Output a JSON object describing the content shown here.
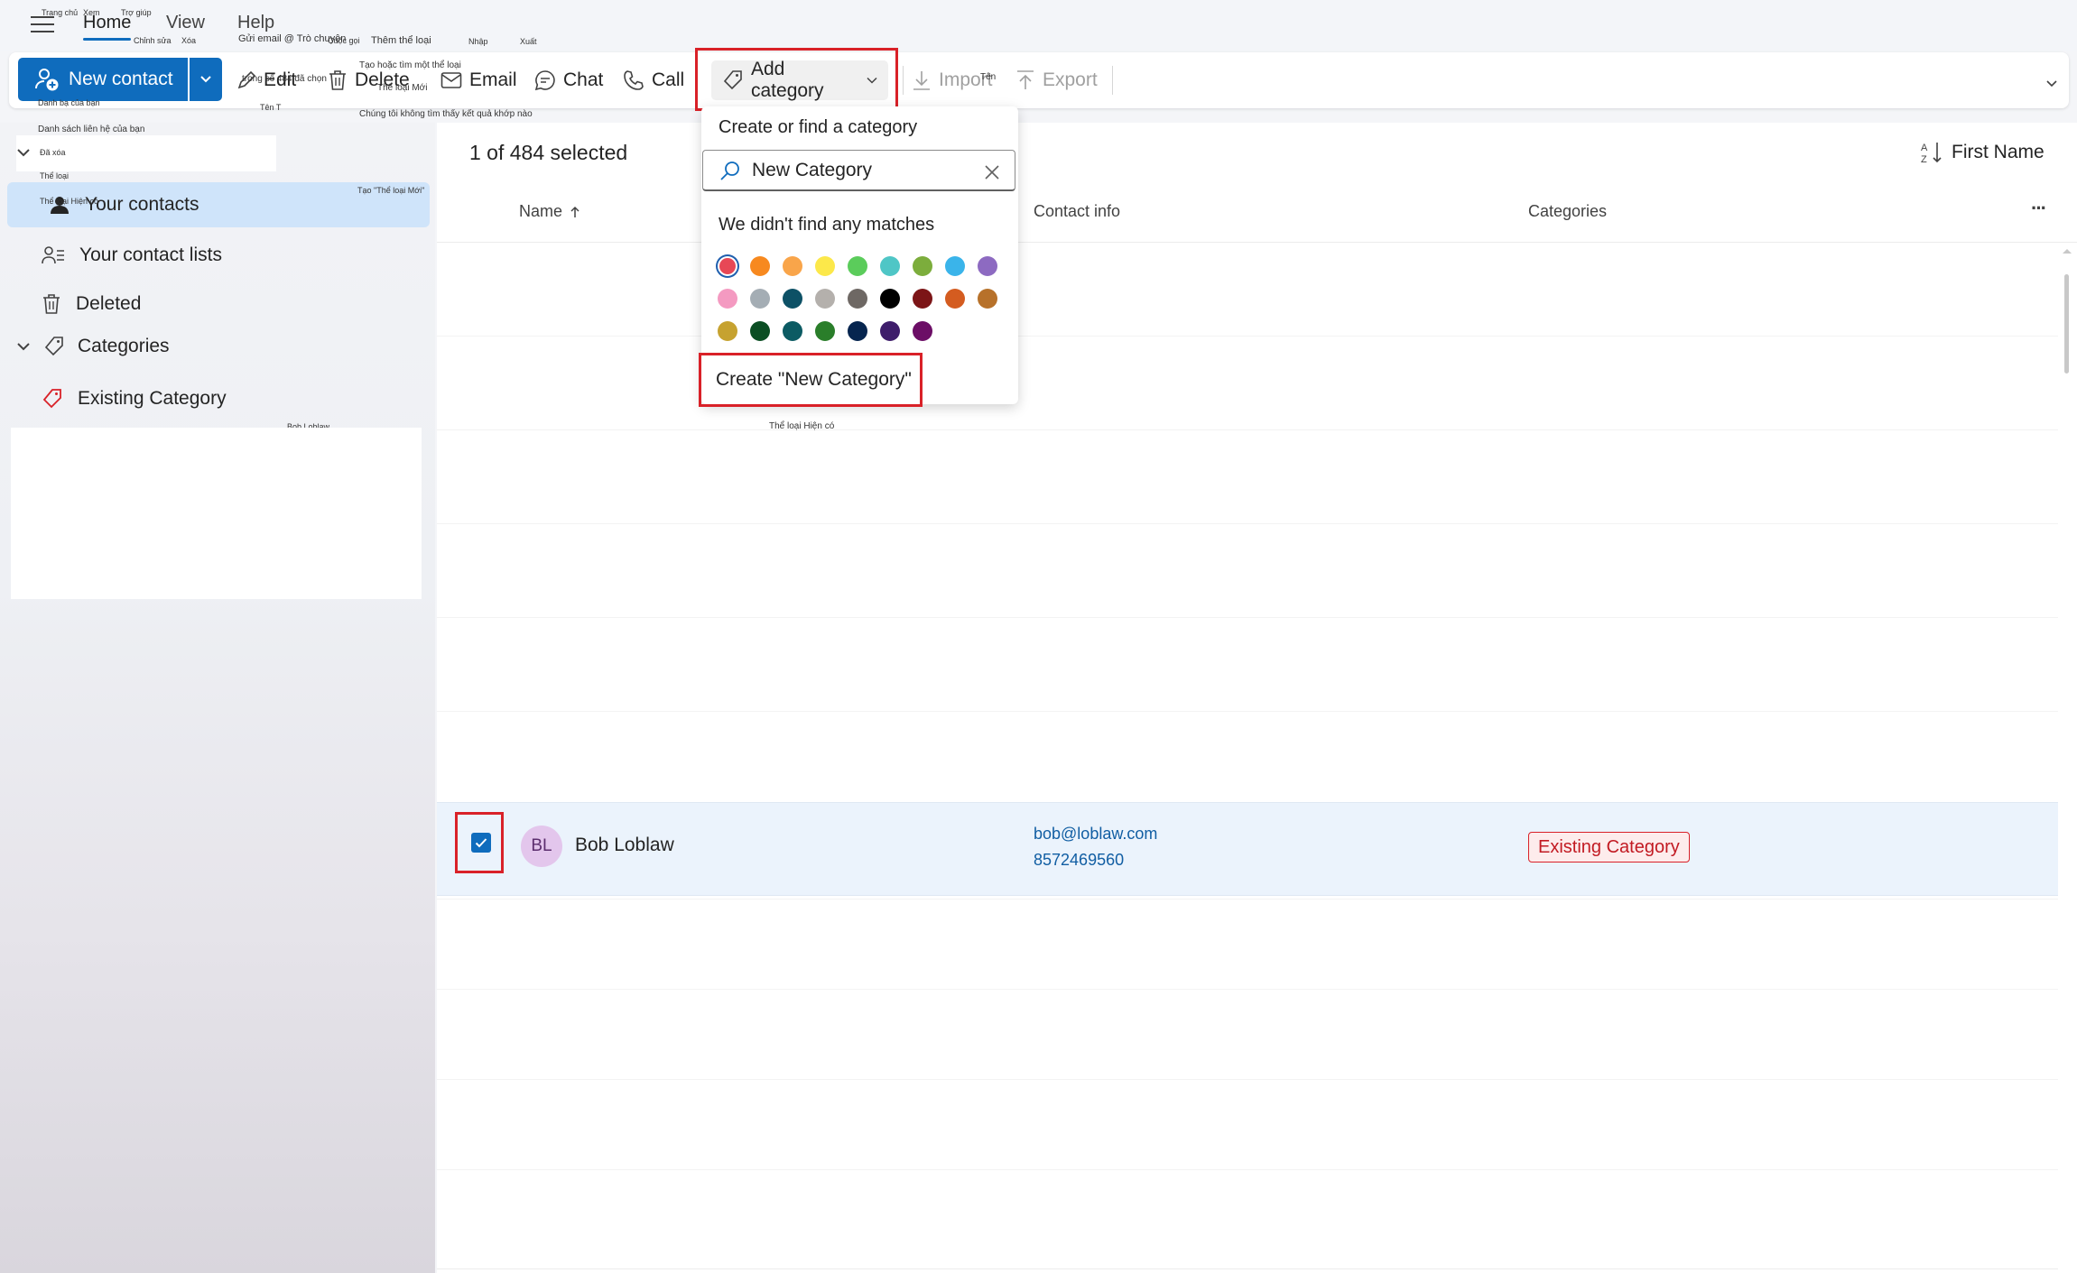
{
  "tabs": {
    "home": "Home",
    "view": "View",
    "help": "Help"
  },
  "ribbon": {
    "new_contact": "New contact",
    "edit": "Edit",
    "delete": "Delete",
    "email": "Email",
    "chat": "Chat",
    "call": "Call",
    "add_category": "Add category",
    "import": "Import",
    "export": "Export"
  },
  "overlay_labels": {
    "home_vi": "Trang chủ",
    "view_vi": "Xem",
    "help_vi": "Trợ giúp",
    "edit_vi": "Chỉnh sửa",
    "delete_vi": "Xóa",
    "email_chat_vi": "Gửi email @ Trò chuyện",
    "call_vi": "Cuộc gọi",
    "add_category_vi": "Thêm thể loại",
    "import_vi": "Nhập",
    "export_vi": "Xuất",
    "name_vi": "Tên",
    "new_contact_vi": "Danh bạ của bạn",
    "selected_vi": "trong số 484 đã chọn",
    "find_category_vi": "Tạo hoặc tìm một thể loại",
    "new_category_vi": "Thể loại Mới",
    "name_short_vi": "Tên T",
    "no_match_vi": "Chúng tôi không tìm thấy kết quả khớp nào",
    "contact_lists_vi": "Danh sách liên hệ của bạn",
    "deleted_vi": "Đã xóa",
    "categories_vi": "Thể loại",
    "existing_vi": "Thể loại Hiện có",
    "create_vi": "Tạo \"Thể loại Mới\"",
    "bob_label": "Bob Loblaw",
    "existing_vi_2": "Thể loại Hiện có"
  },
  "sidebar": {
    "your_contacts": "Your contacts",
    "your_contact_lists": "Your contact lists",
    "deleted": "Deleted",
    "categories": "Categories",
    "existing_category": "Existing Category"
  },
  "list": {
    "selection_count": "1 of 484 selected",
    "sort_label": "First Name",
    "col_name": "Name",
    "col_contact_info": "Contact info",
    "col_categories": "Categories",
    "more": "···"
  },
  "contact": {
    "initials": "BL",
    "name": "Bob Loblaw",
    "email": "bob@loblaw.com",
    "phone": "8572469560",
    "category": "Existing Category"
  },
  "dropdown": {
    "heading": "Create or find a category",
    "search_value": "New Category",
    "no_matches": "We didn't find any matches",
    "create_button": "Create \"New Category\"",
    "colors": [
      "#e74856",
      "#f7891f",
      "#f9a54a",
      "#fce84a",
      "#5bcc5b",
      "#4fc6c6",
      "#7cad3c",
      "#3ab4ea",
      "#8d6ac1",
      "#f49ac1",
      "#a4adb4",
      "#0d5166",
      "#b4b0ac",
      "#6e6864",
      "#000000",
      "#7c1517",
      "#d45c20",
      "#b7712a",
      "#c6a230",
      "#0b4e23",
      "#0c5b63",
      "#2a7e2a",
      "#06254f",
      "#3e1d6b",
      "#6c0e66"
    ]
  }
}
